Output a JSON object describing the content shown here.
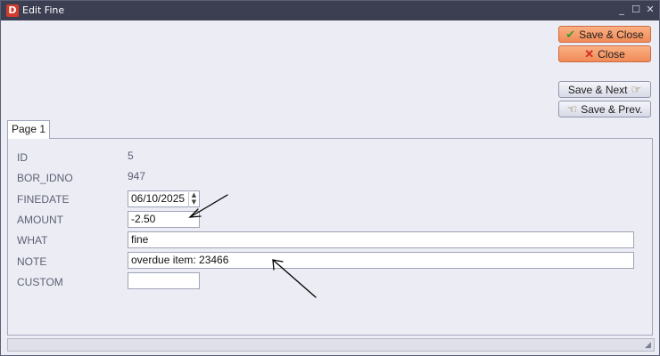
{
  "window": {
    "title": "Edit Fine",
    "app_icon_letter": "D"
  },
  "window_controls": {
    "minimize": "_",
    "maximize": "☐",
    "close": "✕"
  },
  "buttons": {
    "save_close": "Save & Close",
    "close": "Close",
    "save_next": "Save & Next",
    "save_prev": "Save & Prev."
  },
  "icons": {
    "check": "✔",
    "x": "✕",
    "hand_right": "☞",
    "hand_left": "☜",
    "spin_up": "▲",
    "spin_down": "▼",
    "grip": "◢"
  },
  "tabs": [
    {
      "label": "Page 1",
      "active": true
    }
  ],
  "fields": {
    "id": {
      "label": "ID",
      "value": "5"
    },
    "bor_idno": {
      "label": "BOR_IDNO",
      "value": "947"
    },
    "finedate": {
      "label": "FINEDATE",
      "value": "06/10/2025"
    },
    "amount": {
      "label": "AMOUNT",
      "value": "-2.50"
    },
    "what": {
      "label": "WHAT",
      "value": "fine"
    },
    "note": {
      "label": "NOTE",
      "value": "overdue item: 23466"
    },
    "custom": {
      "label": "CUSTOM",
      "value": ""
    }
  },
  "colors": {
    "titlebar": "#3c3e52",
    "primary_button": "#f08a58",
    "window_bg": "#ecedf4"
  }
}
